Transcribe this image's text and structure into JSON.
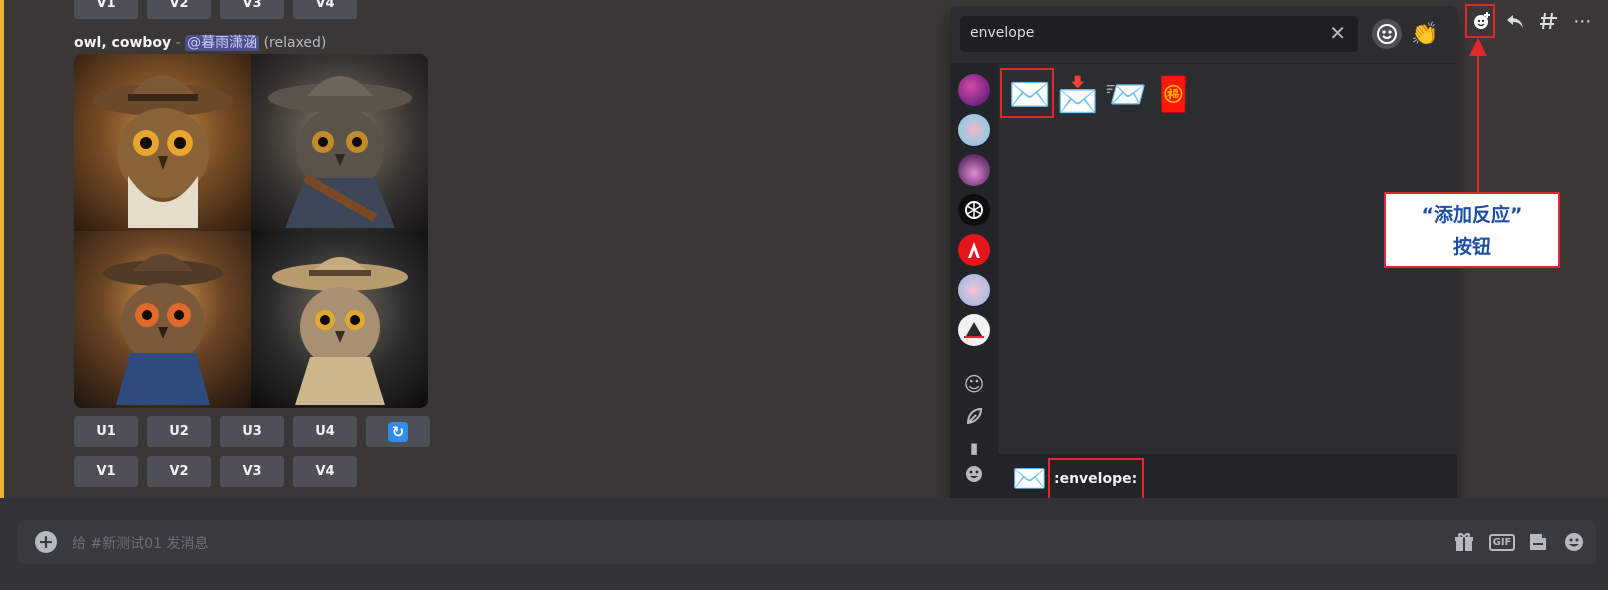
{
  "message": {
    "prev_variation_buttons": [
      "V1",
      "V2",
      "V3",
      "V4"
    ],
    "prompt": "owl, cowboy",
    "separator": " - ",
    "mention": "@暮雨潇涵",
    "mode": "(relaxed)",
    "upscale_buttons": [
      "U1",
      "U2",
      "U3",
      "U4"
    ],
    "variation_buttons": [
      "V1",
      "V2",
      "V3",
      "V4"
    ]
  },
  "emoji_picker": {
    "search_value": "envelope",
    "results": [
      {
        "glyph": "✉️",
        "name": "envelope"
      },
      {
        "glyph": "📩",
        "name": "envelope-with-arrow-icon"
      },
      {
        "glyph": "📨",
        "name": "incoming-envelope-icon"
      },
      {
        "glyph": "🧧",
        "name": "red-envelope-icon"
      }
    ],
    "preview": {
      "glyph": "✉️",
      "name": ":envelope:"
    }
  },
  "annotation": {
    "line1": "“添加反应”",
    "line2": "按钮"
  },
  "composer": {
    "placeholder": "给 #新测试01 发消息"
  },
  "colors": {
    "highlight": "#e0262f",
    "annotation_text": "#1d4ea3",
    "mention_bar": "#f0b232"
  }
}
